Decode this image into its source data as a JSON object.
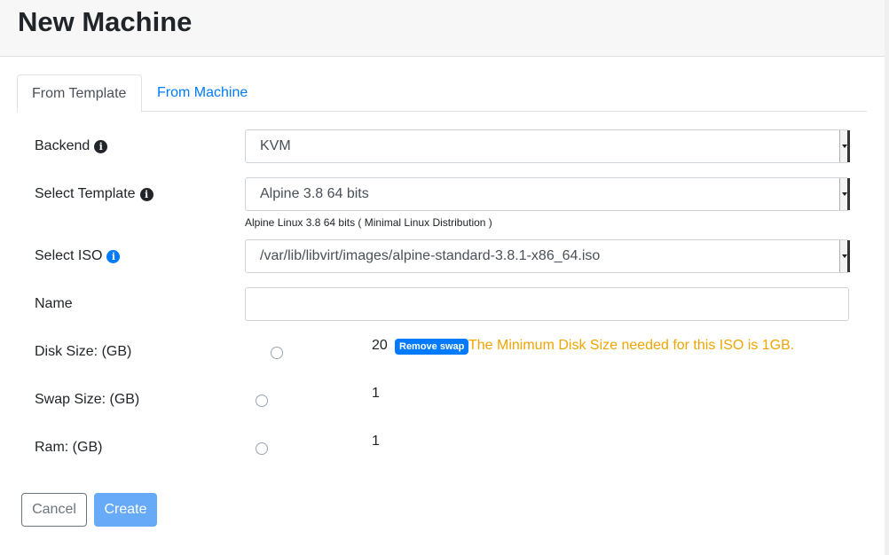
{
  "header": {
    "title": "New Machine"
  },
  "tabs": [
    {
      "label": "From Template",
      "active": true
    },
    {
      "label": "From Machine",
      "active": false
    }
  ],
  "form": {
    "backend": {
      "label": "Backend",
      "value": "KVM"
    },
    "template": {
      "label": "Select Template",
      "value": "Alpine 3.8 64 bits",
      "hint": "Alpine Linux 3.8 64 bits ( Minimal Linux Distribution )"
    },
    "iso": {
      "label": "Select ISO",
      "value": "/var/lib/libvirt/images/alpine-standard-3.8.1-x86_64.iso"
    },
    "name": {
      "label": "Name",
      "value": ""
    },
    "disk": {
      "label": "Disk Size: (GB)",
      "value": "20",
      "badge": "Remove swap",
      "warning": "The Minimum Disk Size needed for this ISO is 1GB."
    },
    "swap": {
      "label": "Swap Size: (GB)",
      "value": "1"
    },
    "ram": {
      "label": "Ram: (GB)",
      "value": "1"
    }
  },
  "buttons": {
    "cancel": "Cancel",
    "create": "Create"
  },
  "icons": {
    "info": "info-circle-icon"
  },
  "colors": {
    "primary": "#007bff",
    "warning": "#f0a500",
    "create_button": "#66aaf8"
  }
}
